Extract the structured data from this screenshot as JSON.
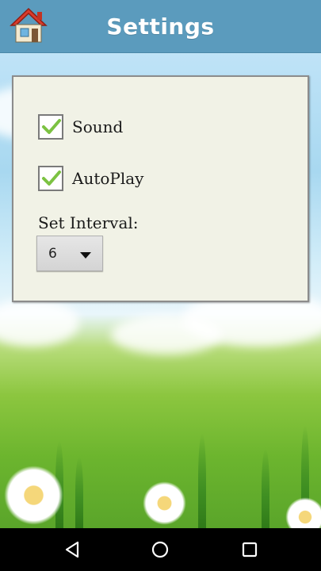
{
  "header": {
    "title": "Settings",
    "home_icon": "home-icon"
  },
  "settings": {
    "sound": {
      "label": "Sound",
      "checked": true
    },
    "autoplay": {
      "label": "AutoPlay",
      "checked": true
    },
    "interval": {
      "label": "Set Interval:",
      "value": "6"
    }
  },
  "navbar": {
    "back_icon": "back-icon",
    "home_icon": "home-circle-icon",
    "recents_icon": "recents-icon"
  },
  "colors": {
    "header_bg": "#5b9bbd",
    "panel_bg": "#f1f2e6",
    "check_green": "#7cc242"
  }
}
